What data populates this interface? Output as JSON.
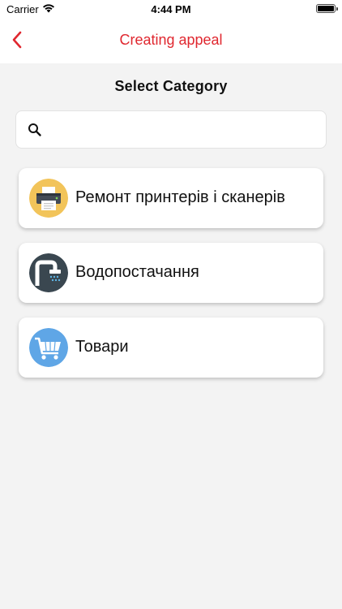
{
  "status_bar": {
    "carrier": "Carrier",
    "time": "4:44 PM",
    "wifi_icon": "wifi-icon",
    "battery_icon": "battery-icon"
  },
  "nav": {
    "back_icon": "chevron-left-icon",
    "title": "Creating appeal",
    "accent_color": "#e0272f"
  },
  "section_title": "Select Category",
  "search": {
    "icon": "search-icon",
    "value": "",
    "placeholder": ""
  },
  "categories": [
    {
      "label": "Ремонт принтерів і сканерів",
      "icon": "printer-icon",
      "icon_bg": "#f2c45a"
    },
    {
      "label": "Водопостачання",
      "icon": "shower-icon",
      "icon_bg": "#3a4750"
    },
    {
      "label": "Товари",
      "icon": "cart-icon",
      "icon_bg": "#5fa6e6"
    }
  ]
}
